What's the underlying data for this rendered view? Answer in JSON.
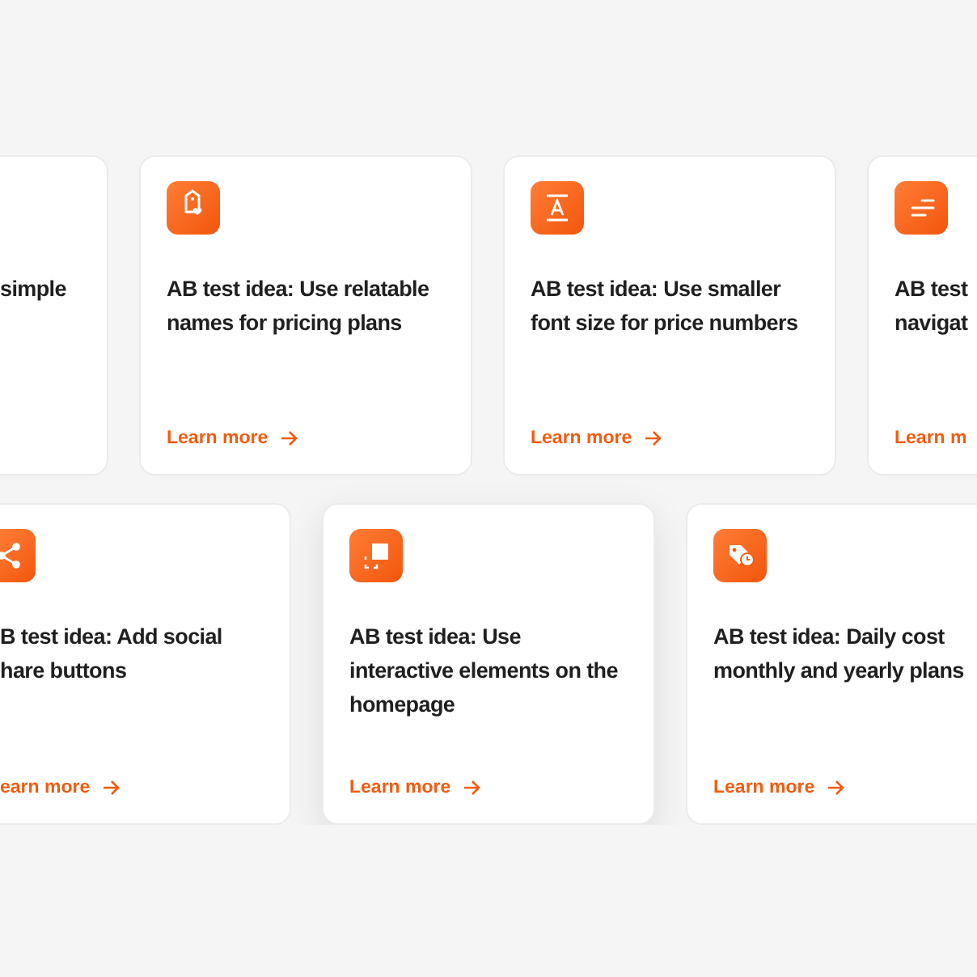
{
  "rows": [
    {
      "cards": [
        {
          "title": "simple"
        },
        {
          "kind": "tag-heart",
          "title": "AB test idea: Use relatable\nnames for pricing plans",
          "link": "Learn more"
        },
        {
          "kind": "text-size",
          "title": "AB test idea: Use smaller\nfont size for price numbers",
          "link": "Learn more"
        },
        {
          "kind": "lines",
          "title": "AB test\nnavigat",
          "link": "Learn m",
          "arrow": false
        }
      ]
    },
    {
      "cards": [
        {
          "kind": "share",
          "title": "B test idea: Add social\nhare buttons",
          "link": "earn more"
        },
        {
          "kind": "select",
          "raised": true,
          "title": "AB test idea: Use\ninteractive elements on the\nhomepage",
          "link": "Learn more"
        },
        {
          "kind": "tag-clock",
          "raised": false,
          "title": "AB test idea: Daily cost\nmonthly and yearly plans",
          "link": "Learn more"
        }
      ]
    }
  ]
}
